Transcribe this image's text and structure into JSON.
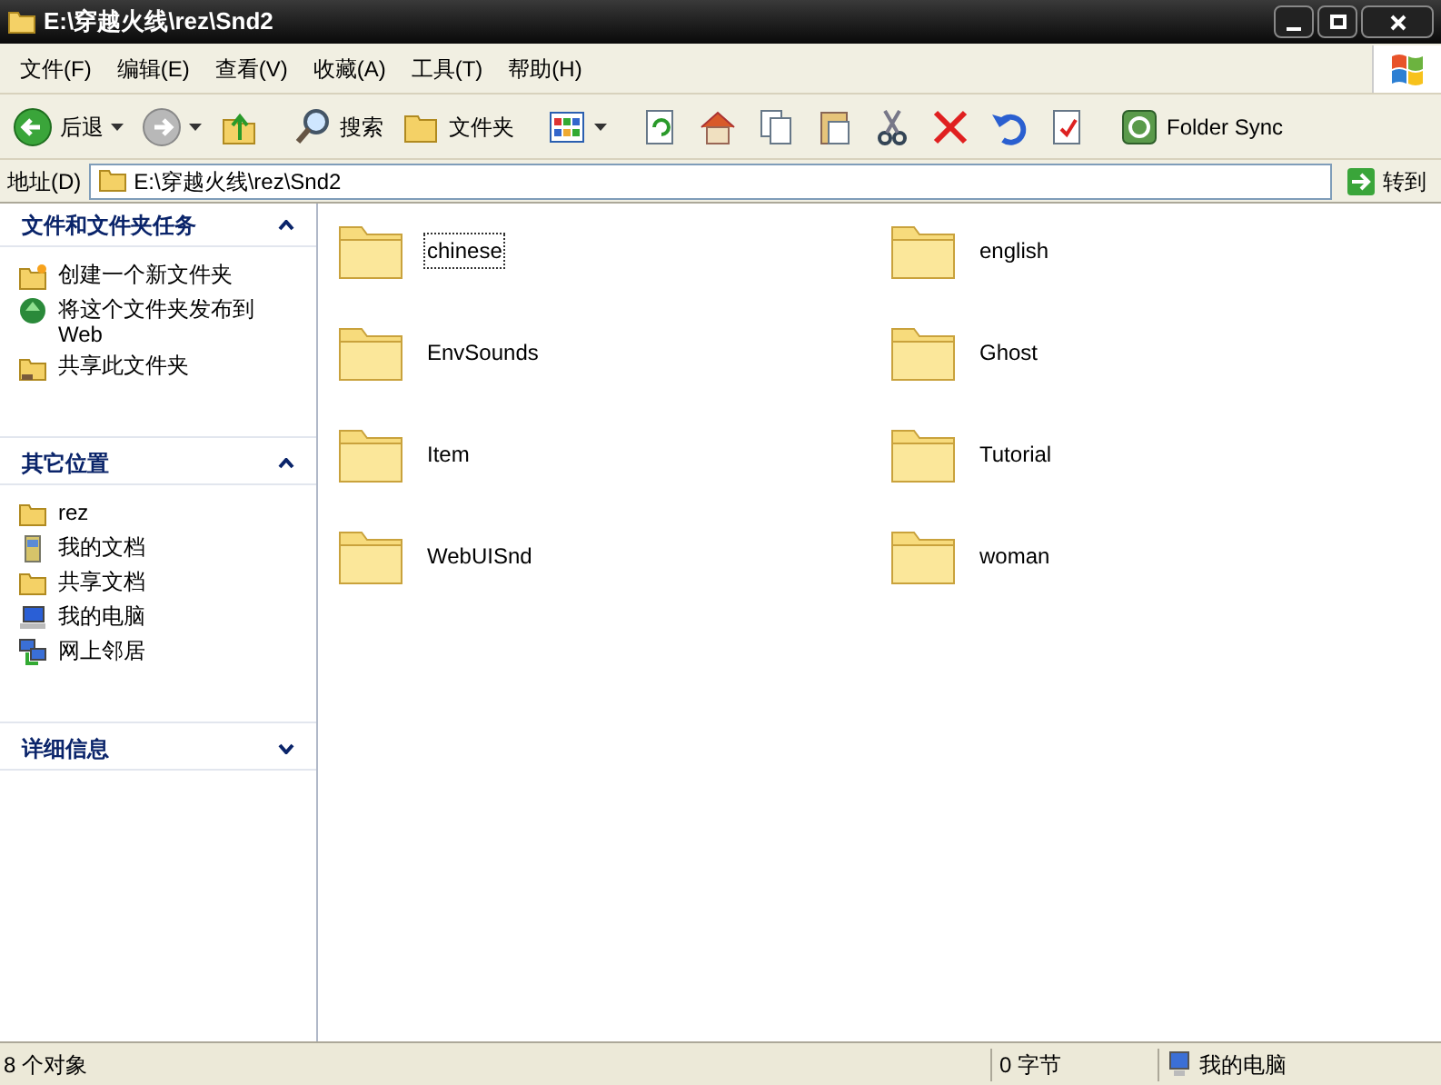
{
  "window": {
    "title": "E:\\穿越火线\\rez\\Snd2"
  },
  "menu": [
    "文件(F)",
    "编辑(E)",
    "查看(V)",
    "收藏(A)",
    "工具(T)",
    "帮助(H)"
  ],
  "toolbar": [
    {
      "kind": "back",
      "label": "后退"
    },
    {
      "kind": "forward"
    },
    {
      "kind": "up"
    },
    {
      "kind": "search",
      "label": "搜索"
    },
    {
      "kind": "folders",
      "label": "文件夹"
    },
    {
      "kind": "views"
    },
    {
      "kind": "refresh"
    },
    {
      "kind": "home"
    },
    {
      "kind": "copy"
    },
    {
      "kind": "paste"
    },
    {
      "kind": "cut"
    },
    {
      "kind": "delete"
    },
    {
      "kind": "undo"
    },
    {
      "kind": "properties"
    },
    {
      "kind": "sync",
      "label": "Folder Sync"
    }
  ],
  "address": {
    "label": "地址(D)",
    "value": "E:\\穿越火线\\rez\\Snd2",
    "go": "转到"
  },
  "sidebar": [
    {
      "title": "文件和文件夹任务",
      "expanded": true,
      "items": [
        {
          "kind": "newfolder",
          "label": "创建一个新文件夹"
        },
        {
          "kind": "web",
          "label": "将这个文件夹发布到 Web"
        },
        {
          "kind": "share",
          "label": "共享此文件夹"
        }
      ]
    },
    {
      "title": "其它位置",
      "expanded": true,
      "items": [
        {
          "kind": "folder",
          "label": "rez"
        },
        {
          "kind": "docs",
          "label": "我的文档"
        },
        {
          "kind": "folder",
          "label": "共享文档"
        },
        {
          "kind": "computer",
          "label": "我的电脑"
        },
        {
          "kind": "network",
          "label": "网上邻居"
        }
      ]
    },
    {
      "title": "详细信息",
      "expanded": false
    }
  ],
  "files": [
    {
      "name": "chinese",
      "selected": true
    },
    {
      "name": "english",
      "selected": false
    },
    {
      "name": "EnvSounds",
      "selected": false
    },
    {
      "name": "Ghost",
      "selected": false
    },
    {
      "name": "Item",
      "selected": false
    },
    {
      "name": "Tutorial",
      "selected": false
    },
    {
      "name": "WebUISnd",
      "selected": false
    },
    {
      "name": "woman",
      "selected": false
    }
  ],
  "status_bar": {
    "objects": "8 个对象",
    "size": "0 字节",
    "location": "我的电脑"
  }
}
